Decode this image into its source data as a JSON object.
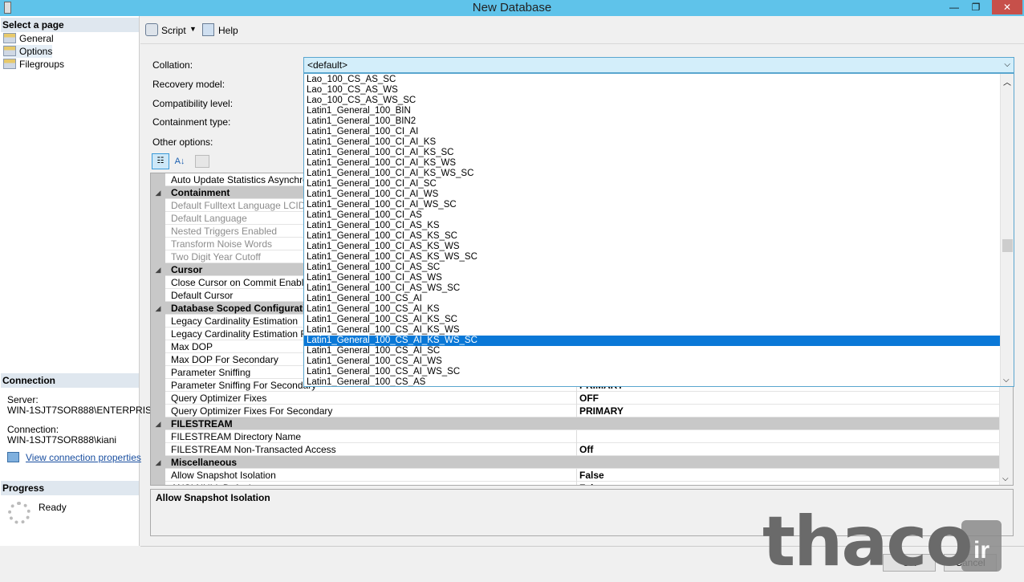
{
  "window": {
    "title": "New Database",
    "min": "—",
    "restore": "❐",
    "close": "✕"
  },
  "left": {
    "select_header": "Select a page",
    "pages": [
      "General",
      "Options",
      "Filegroups"
    ],
    "connection_header": "Connection",
    "server_label": "Server:",
    "server": "WIN-1SJT7SOR888\\ENTERPRIS",
    "connection_label": "Connection:",
    "connection": "WIN-1SJT7SOR888\\kiani",
    "view_link": "View connection properties",
    "progress_header": "Progress",
    "progress_status": "Ready"
  },
  "toolbar": {
    "script": "Script",
    "help": "Help"
  },
  "form": {
    "collation_label": "Collation:",
    "recovery_label": "Recovery model:",
    "compat_label": "Compatibility level:",
    "containment_label": "Containment type:",
    "other_label": "Other options:",
    "collation_value": "<default>"
  },
  "collation_options": [
    "Lao_100_CS_AS_SC",
    "Lao_100_CS_AS_WS",
    "Lao_100_CS_AS_WS_SC",
    "Latin1_General_100_BIN",
    "Latin1_General_100_BIN2",
    "Latin1_General_100_CI_AI",
    "Latin1_General_100_CI_AI_KS",
    "Latin1_General_100_CI_AI_KS_SC",
    "Latin1_General_100_CI_AI_KS_WS",
    "Latin1_General_100_CI_AI_KS_WS_SC",
    "Latin1_General_100_CI_AI_SC",
    "Latin1_General_100_CI_AI_WS",
    "Latin1_General_100_CI_AI_WS_SC",
    "Latin1_General_100_CI_AS",
    "Latin1_General_100_CI_AS_KS",
    "Latin1_General_100_CI_AS_KS_SC",
    "Latin1_General_100_CI_AS_KS_WS",
    "Latin1_General_100_CI_AS_KS_WS_SC",
    "Latin1_General_100_CI_AS_SC",
    "Latin1_General_100_CI_AS_WS",
    "Latin1_General_100_CI_AS_WS_SC",
    "Latin1_General_100_CS_AI",
    "Latin1_General_100_CS_AI_KS",
    "Latin1_General_100_CS_AI_KS_SC",
    "Latin1_General_100_CS_AI_KS_WS",
    "Latin1_General_100_CS_AI_KS_WS_SC",
    "Latin1_General_100_CS_AI_SC",
    "Latin1_General_100_CS_AI_WS",
    "Latin1_General_100_CS_AI_WS_SC",
    "Latin1_General_100_CS_AS"
  ],
  "selected_option": "Latin1_General_100_CS_AI_KS_WS_SC",
  "properties": [
    {
      "name": "Auto Update Statistics Asynchronously",
      "value": ""
    },
    {
      "name": "Containment",
      "cat": true
    },
    {
      "name": "Default Fulltext Language LCID",
      "dis": true
    },
    {
      "name": "Default Language",
      "dis": true
    },
    {
      "name": "Nested Triggers Enabled",
      "dis": true
    },
    {
      "name": "Transform Noise Words",
      "dis": true
    },
    {
      "name": "Two Digit Year Cutoff",
      "dis": true
    },
    {
      "name": "Cursor",
      "cat": true
    },
    {
      "name": "Close Cursor on Commit Enabled"
    },
    {
      "name": "Default Cursor"
    },
    {
      "name": "Database Scoped Configurations",
      "cat": true
    },
    {
      "name": "Legacy Cardinality Estimation"
    },
    {
      "name": "Legacy Cardinality Estimation For Secondary"
    },
    {
      "name": "Max DOP"
    },
    {
      "name": "Max DOP For Secondary"
    },
    {
      "name": "Parameter Sniffing"
    },
    {
      "name": "Parameter Sniffing For Secondary",
      "value": "PRIMARY"
    },
    {
      "name": "Query Optimizer Fixes",
      "value": "OFF"
    },
    {
      "name": "Query Optimizer Fixes For Secondary",
      "value": "PRIMARY"
    },
    {
      "name": "FILESTREAM",
      "cat": true
    },
    {
      "name": "FILESTREAM Directory Name",
      "value": ""
    },
    {
      "name": "FILESTREAM Non-Transacted Access",
      "value": "Off"
    },
    {
      "name": "Miscellaneous",
      "cat": true
    },
    {
      "name": "Allow Snapshot Isolation",
      "value": "False"
    },
    {
      "name": "ANSI NULL Default",
      "value": "False"
    }
  ],
  "description": "Allow Snapshot Isolation",
  "buttons": {
    "ok": "OK",
    "cancel": "Cancel"
  },
  "watermark": "thaco.ir"
}
